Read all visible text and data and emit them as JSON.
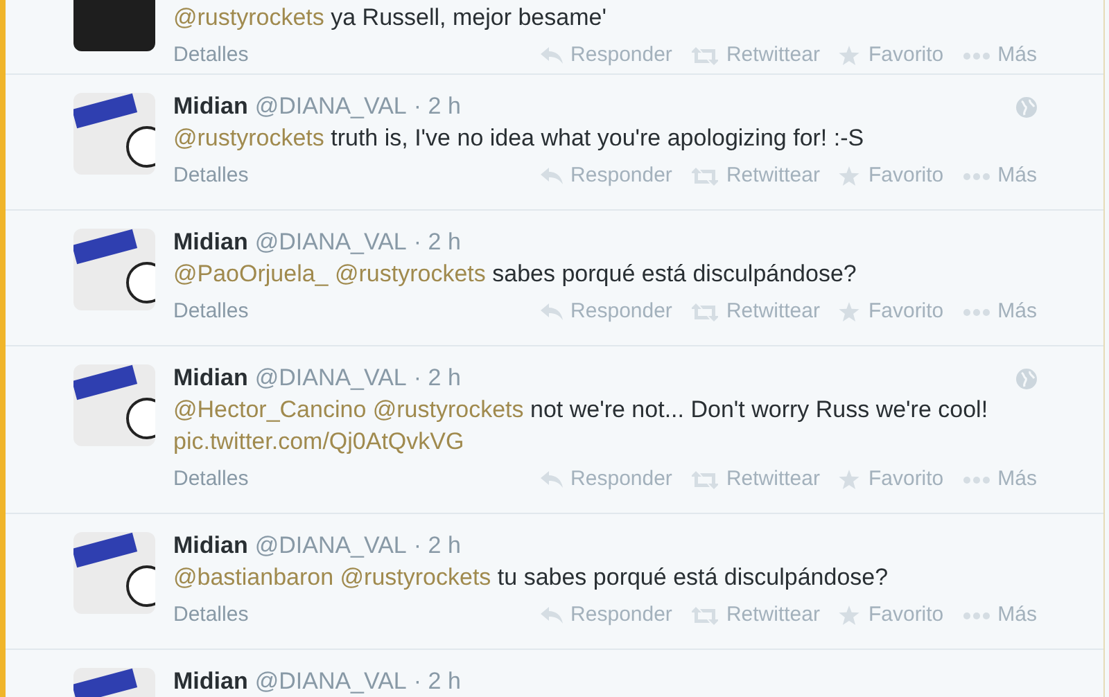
{
  "tweets": [
    {
      "kind": "dark",
      "geo": false,
      "segments": [
        {
          "kind": "mention",
          "text": "@rustyrockets"
        },
        {
          "kind": "plain",
          "text": "ya Russell, mejor besame'"
        }
      ],
      "details": "Detalles",
      "actions": [
        "Responder",
        "Retwittear",
        "Favorito",
        "Más"
      ]
    },
    {
      "kind": "shoe",
      "name": "Midian",
      "handle": "@DIANA_VAL",
      "time": "· 2 h",
      "geo": true,
      "segments": [
        {
          "kind": "mention",
          "text": "@rustyrockets"
        },
        {
          "kind": "plain",
          "text": "truth is, I've no idea what you're apologizing for!  :-S"
        }
      ],
      "details": "Detalles",
      "actions": [
        "Responder",
        "Retwittear",
        "Favorito",
        "Más"
      ]
    },
    {
      "kind": "shoe",
      "name": "Midian",
      "handle": "@DIANA_VAL",
      "time": "· 2 h",
      "geo": false,
      "segments": [
        {
          "kind": "mention",
          "text": "@PaoOrjuela_"
        },
        {
          "kind": "mention",
          "text": "@rustyrockets"
        },
        {
          "kind": "plain",
          "text": "sabes porqué está disculpándose?"
        }
      ],
      "details": "Detalles",
      "actions": [
        "Responder",
        "Retwittear",
        "Favorito",
        "Más"
      ]
    },
    {
      "kind": "shoe",
      "name": "Midian",
      "handle": "@DIANA_VAL",
      "time": "· 2 h",
      "geo": true,
      "segments": [
        {
          "kind": "mention",
          "text": "@Hector_Cancino"
        },
        {
          "kind": "mention",
          "text": "@rustyrockets"
        },
        {
          "kind": "plain",
          "text": "not we're not... Don't worry Russ we're cool!"
        },
        {
          "kind": "link",
          "text": "pic.twitter.com/Qj0AtQvkVG"
        }
      ],
      "details": "Detalles",
      "actions": [
        "Responder",
        "Retwittear",
        "Favorito",
        "Más"
      ]
    },
    {
      "kind": "shoe",
      "name": "Midian",
      "handle": "@DIANA_VAL",
      "time": "· 2 h",
      "geo": false,
      "segments": [
        {
          "kind": "mention",
          "text": "@bastianbaron"
        },
        {
          "kind": "mention",
          "text": "@rustyrockets"
        },
        {
          "kind": "plain",
          "text": "tu sabes porqué está disculpándose?"
        }
      ],
      "details": "Detalles",
      "actions": [
        "Responder",
        "Retwittear",
        "Favorito",
        "Más"
      ]
    },
    {
      "kind": "shoe",
      "name": "Midian",
      "handle": "@DIANA_VAL",
      "time": "· 2 h",
      "geo": false
    }
  ]
}
